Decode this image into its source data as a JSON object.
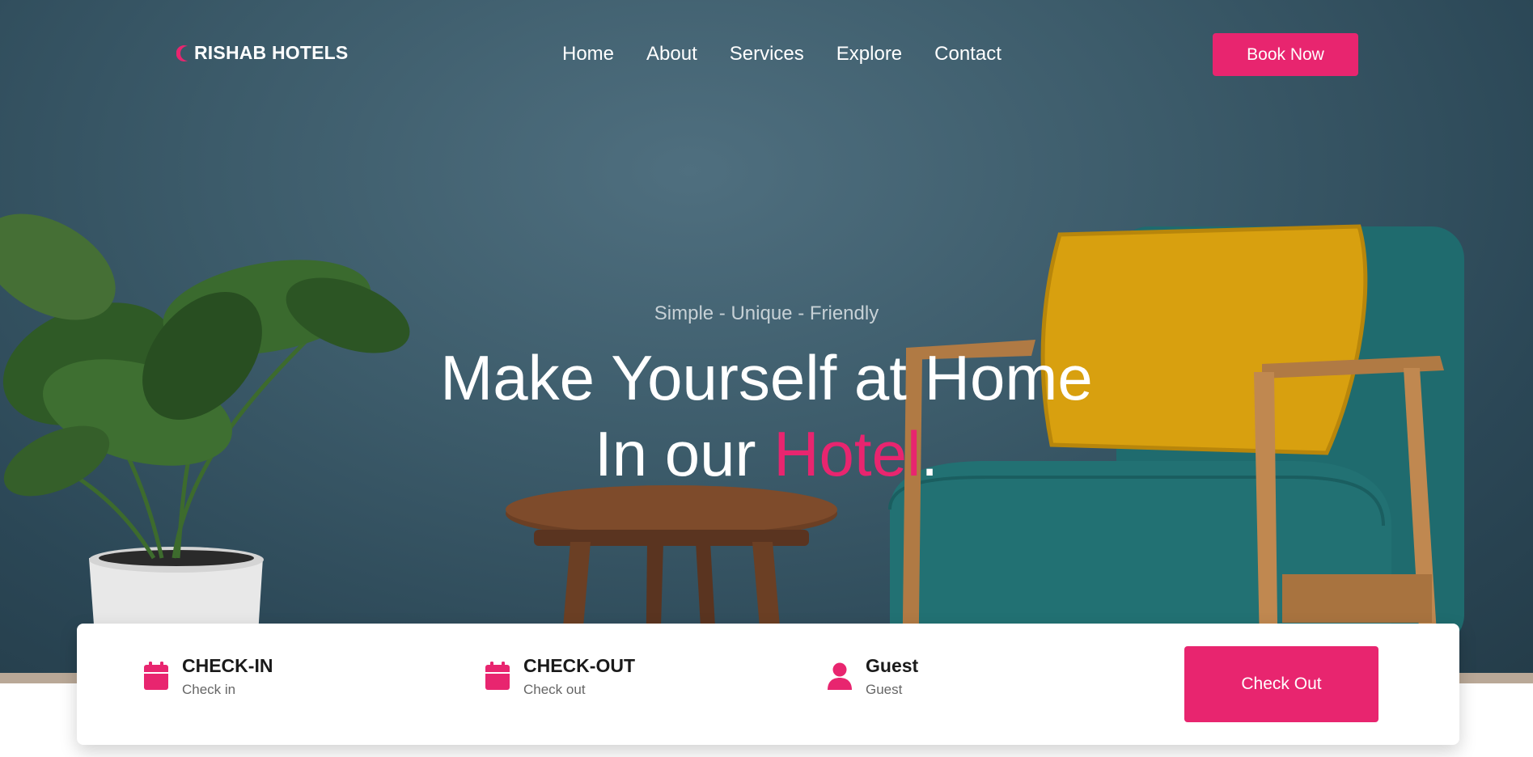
{
  "brand": {
    "name": "RISHAB HOTELS",
    "icon": "moon-icon"
  },
  "nav": {
    "items": [
      "Home",
      "About",
      "Services",
      "Explore",
      "Contact"
    ]
  },
  "book_now": {
    "label": "Book Now"
  },
  "hero": {
    "tagline": "Simple - Unique - Friendly",
    "title_line1": "Make Yourself at Home",
    "title_line2_prefix": "In our ",
    "title_line2_accent": "Hotel",
    "title_line2_suffix": "."
  },
  "booking": {
    "check_in": {
      "label": "CHECK-IN",
      "value": "Check in",
      "icon": "calendar-icon"
    },
    "check_out": {
      "label": "CHECK-OUT",
      "value": "Check out",
      "icon": "calendar-icon"
    },
    "guest": {
      "label": "Guest",
      "value": "Guest",
      "icon": "user-icon"
    },
    "submit_label": "Check Out"
  },
  "colors": {
    "accent": "#e8256f",
    "wall": "#3c5b6a",
    "text_light": "#ffffff"
  }
}
